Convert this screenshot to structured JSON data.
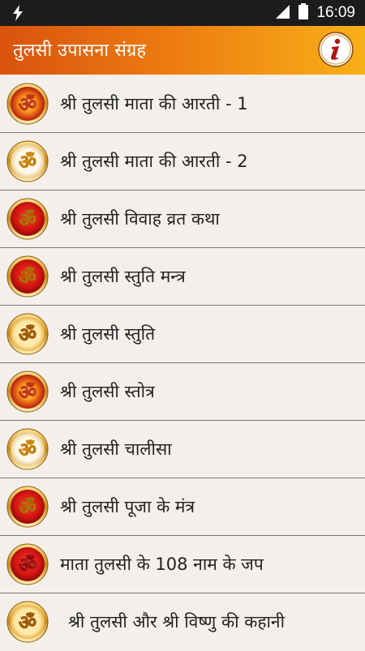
{
  "status_bar": {
    "time": "16:09"
  },
  "app_bar": {
    "title": "तुलसी उपासना संग्रह",
    "info_icon": "info-icon"
  },
  "items": [
    {
      "label": "श्री तुलसी माता की आरती - 1",
      "icon": "om-icon",
      "style": "sunburst"
    },
    {
      "label": "श्री तुलसी माता की आरती - 2",
      "icon": "om-icon",
      "style": "white"
    },
    {
      "label": "श्री तुलसी विवाह व्रत कथा",
      "icon": "om-icon",
      "style": "red"
    },
    {
      "label": "श्री तुलसी स्तुति मन्त्र",
      "icon": "om-icon",
      "style": "red"
    },
    {
      "label": "श्री तुलसी स्तुति",
      "icon": "om-icon",
      "style": "gold"
    },
    {
      "label": "श्री तुलसी स्तोत्र",
      "icon": "om-icon",
      "style": "sunburst"
    },
    {
      "label": "श्री तुलसी चालीसा",
      "icon": "om-icon",
      "style": "white"
    },
    {
      "label": "श्री तुलसी पूजा के मंत्र",
      "icon": "om-icon",
      "style": "red"
    },
    {
      "label": "माता तुलसी के 108 नाम के जप",
      "icon": "om-icon",
      "style": "red"
    },
    {
      "label": "श्री तुलसी और श्री विष्णु की कहानी",
      "icon": "om-icon",
      "style": "gold"
    }
  ]
}
